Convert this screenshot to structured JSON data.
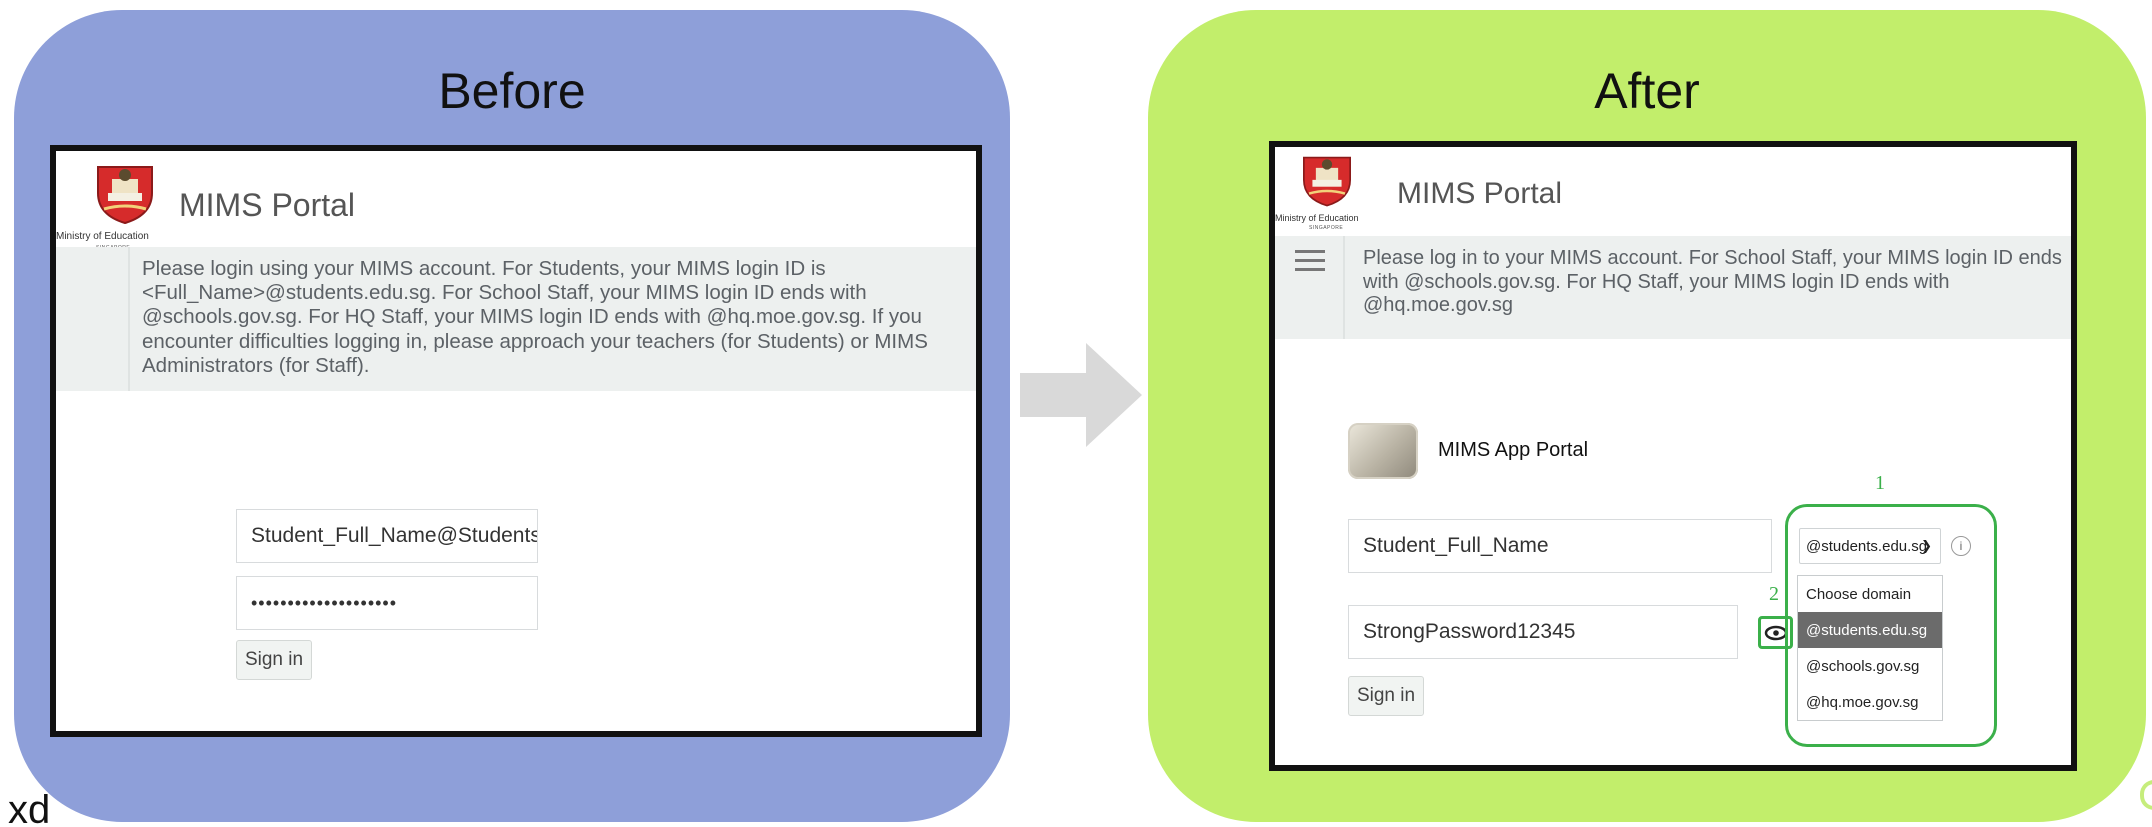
{
  "before": {
    "heading": "Before",
    "org": {
      "name": "Ministry of Education",
      "country": "SINGAPORE"
    },
    "portal_title": "MIMS Portal",
    "info": "Please login using your MIMS account. For Students, your MIMS login ID is <Full_Name>@students.edu.sg. For School Staff, your MIMS login ID ends with @schools.gov.sg. For HQ Staff, your MIMS login ID ends with @hq.moe.gov.sg. If you encounter difficulties logging in, please approach your teachers (for Students) or MIMS Administrators (for Staff).",
    "username_value": "Student_Full_Name@Students.edu",
    "password_value": "••••••••••••••••••••",
    "sign_in_label": "Sign in"
  },
  "after": {
    "heading": "After",
    "org": {
      "name": "Ministry of Education",
      "country": "SINGAPORE"
    },
    "portal_title": "MIMS Portal",
    "info": "Please log in to your MIMS account. For School Staff, your MIMS login ID ends with @schools.gov.sg. For HQ Staff, your MIMS login ID ends with @hq.moe.gov.sg",
    "app_title": "MIMS App Portal",
    "username_value": "Student_Full_Name",
    "domain_selected": "@students.edu.sg",
    "info_icon_label": "i",
    "password_value": "StrongPassword12345",
    "sign_in_label": "Sign in",
    "domain_options": [
      "Choose domain",
      "@students.edu.sg",
      "@schools.gov.sg",
      "@hq.moe.gov.sg"
    ],
    "domain_highlighted": "@students.edu.sg",
    "callout_1": "1",
    "callout_2": "2"
  },
  "stray_text": "xd",
  "colors": {
    "before_bg": "#8e9fd9",
    "after_bg": "#c2ee6b",
    "callout_green": "#3bb04a",
    "arrow_gray": "#d9d9d9"
  },
  "icons": {
    "arrow": "right-arrow-icon",
    "eye": "eye-icon",
    "menu": "hamburger-menu-icon",
    "chevron": "chevron-down-icon",
    "info": "info-icon",
    "logo": "moe-crest-logo",
    "app": "mims-app-icon"
  }
}
